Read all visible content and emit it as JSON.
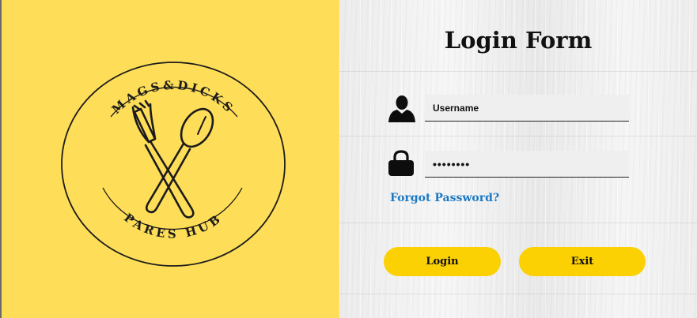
{
  "logo": {
    "top_text": "MAGS&DICKS",
    "bottom_text": "PARES HUB",
    "icon": "fork-and-spoon-icon",
    "background_color": "#fedd58"
  },
  "form": {
    "title": "Login Form",
    "username": {
      "icon": "user-icon",
      "value": "Username"
    },
    "password": {
      "icon": "lock-icon",
      "value": "••••••••"
    },
    "forgot_password": "Forgot Password?",
    "login_button": "Login",
    "exit_button": "Exit",
    "accent_color": "#fcd104",
    "link_color": "#1b79c4"
  }
}
